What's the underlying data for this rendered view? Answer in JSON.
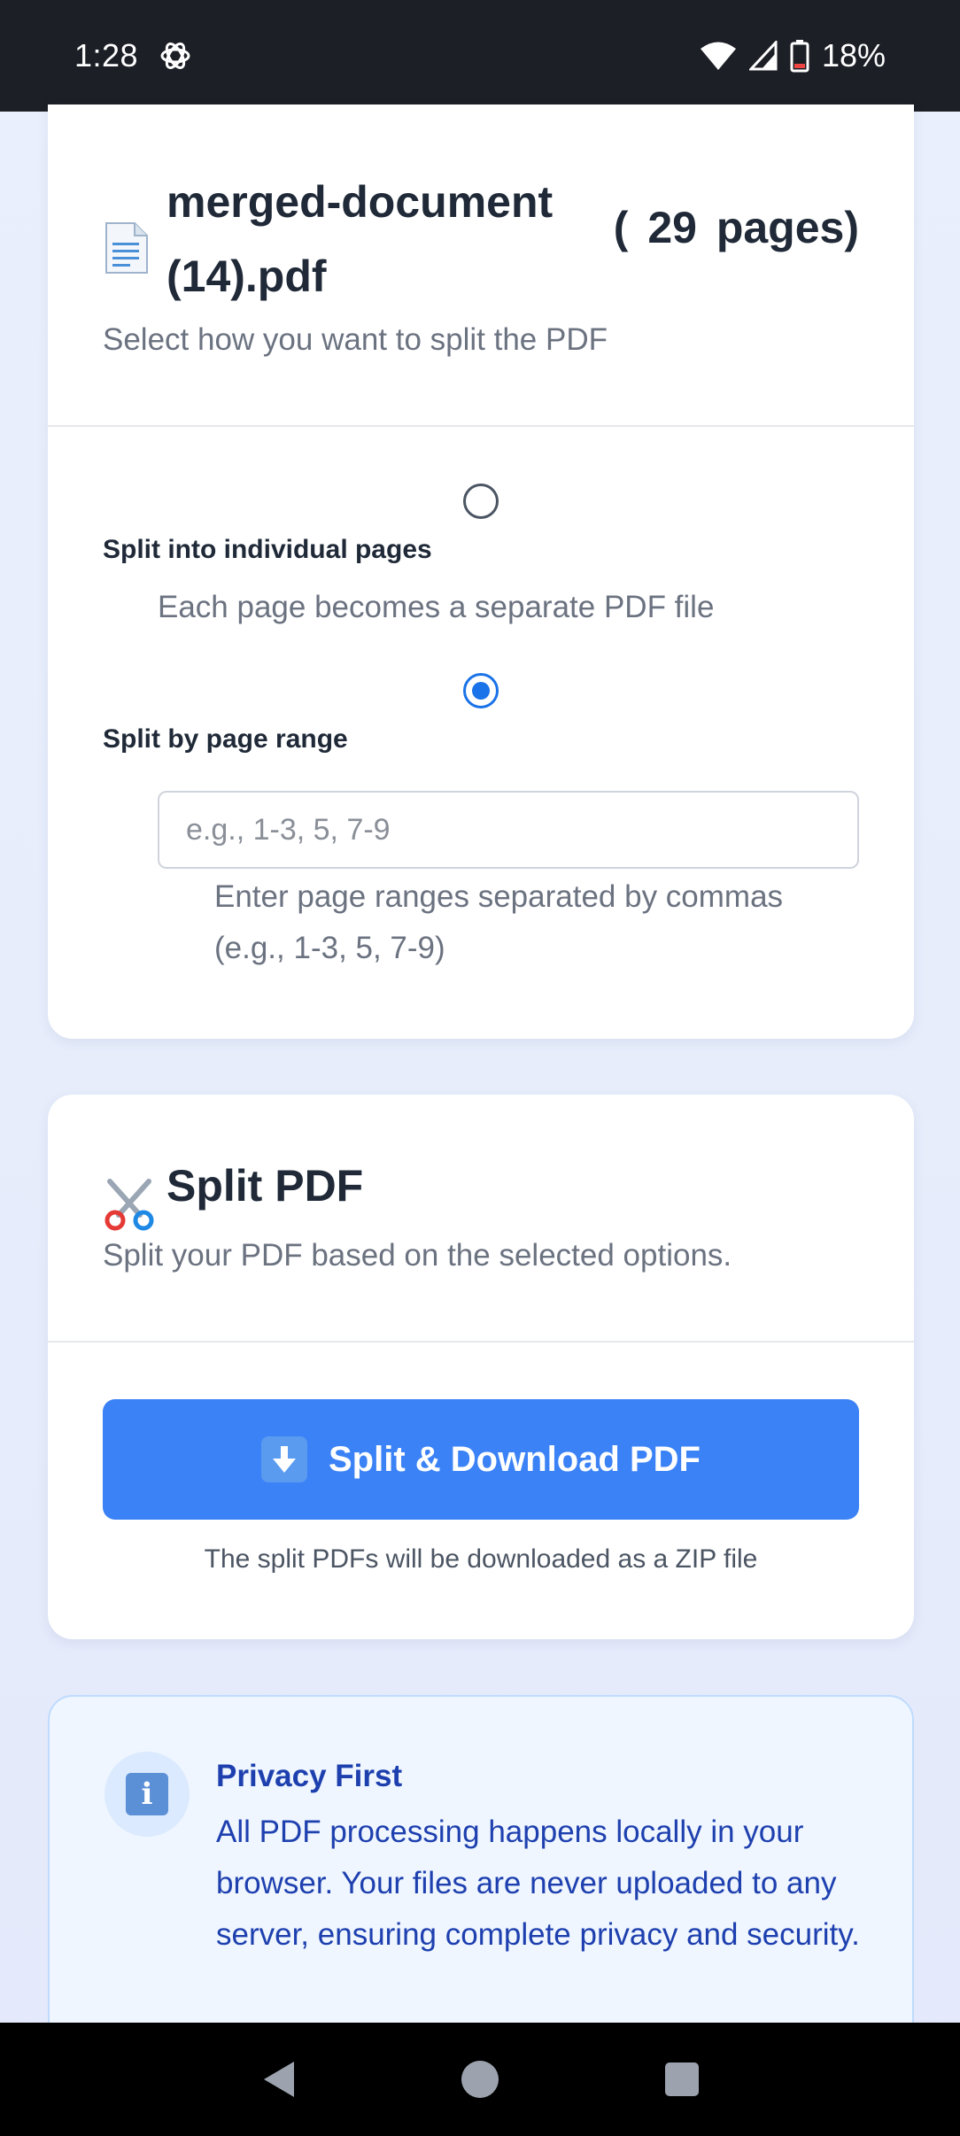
{
  "status_bar": {
    "time": "1:28",
    "battery": "18%",
    "icons": [
      "chatgpt-icon",
      "wifi-icon",
      "signal-icon",
      "battery-icon"
    ]
  },
  "file_card": {
    "file_name": "merged-document (14).pdf",
    "page_count": "( 29 pages)",
    "subtitle": "Select how you want to split the PDF",
    "options": [
      {
        "label": "Split into individual pages",
        "description": "Each page becomes a separate PDF file",
        "checked": false
      },
      {
        "label": "Split by page range",
        "checked": true
      }
    ],
    "range_input": {
      "value": "",
      "placeholder": "e.g., 1-3, 5, 7-9"
    },
    "range_hint": "Enter page ranges separated by commas (e.g., 1-3, 5, 7-9)"
  },
  "split_card": {
    "title": "Split PDF",
    "subtitle": "Split your PDF based on the selected options.",
    "button_label": "Split & Download PDF",
    "note": "The split PDFs will be downloaded as a ZIP file"
  },
  "privacy_card": {
    "title": "Privacy First",
    "text": "All PDF processing happens locally in your browser. Your files are never uploaded to any server, ensuring complete privacy and security."
  },
  "colors": {
    "accent": "#3b82f6",
    "radio_checked": "#1a73e8",
    "privacy_text": "#1e40af",
    "privacy_bg": "#eff6ff"
  }
}
